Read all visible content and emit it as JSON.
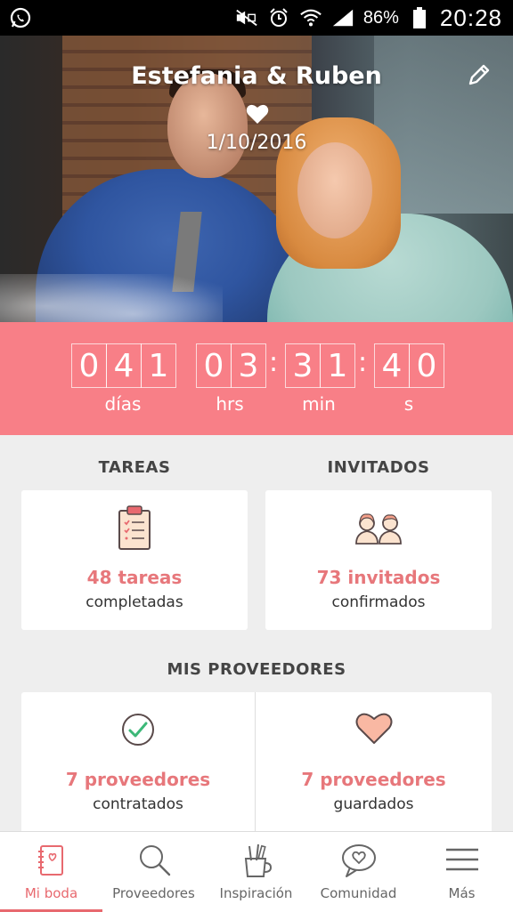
{
  "status_bar": {
    "battery_percent": "86%",
    "time": "20:28",
    "icons": [
      "whatsapp-icon",
      "mute-icon",
      "alarm-icon",
      "wifi-icon",
      "signal-icon",
      "battery-icon"
    ]
  },
  "hero": {
    "couple_names": "Estefania & Ruben",
    "wedding_date": "1/10/2016",
    "icons": [
      "heart-icon",
      "pencil-icon"
    ]
  },
  "countdown": {
    "days_digits": [
      "0",
      "4",
      "1"
    ],
    "hours_digits": [
      "0",
      "3"
    ],
    "minutes_digits": [
      "3",
      "1"
    ],
    "seconds_digits": [
      "4",
      "0"
    ],
    "colon": ":",
    "days_label": "días",
    "hours_label": "hrs",
    "minutes_label": "min",
    "seconds_label": "s"
  },
  "tasks": {
    "title": "TAREAS",
    "count_text": "48 tareas",
    "sub_text": "completadas",
    "icon": "clipboard-icon"
  },
  "guests": {
    "title": "INVITADOS",
    "count_text": "73 invitados",
    "sub_text": "confirmados",
    "icon": "guests-icon"
  },
  "vendors": {
    "title": "MIS PROVEEDORES",
    "hired": {
      "count_text": "7 proveedores",
      "sub_text": "contratados",
      "icon": "check-circle-icon"
    },
    "saved": {
      "count_text": "7 proveedores",
      "sub_text": "guardados",
      "icon": "heart-icon"
    }
  },
  "bottom_nav": {
    "items": [
      {
        "label": "Mi boda",
        "icon": "book-icon",
        "active": true
      },
      {
        "label": "Proveedores",
        "icon": "search-icon",
        "active": false
      },
      {
        "label": "Inspiración",
        "icon": "brush-cup-icon",
        "active": false
      },
      {
        "label": "Comunidad",
        "icon": "chat-heart-icon",
        "active": false
      },
      {
        "label": "Más",
        "icon": "menu-icon",
        "active": false
      }
    ]
  },
  "colors": {
    "accent": "#f87f87",
    "accent_text": "#e7777b",
    "background": "#eeeeee"
  }
}
